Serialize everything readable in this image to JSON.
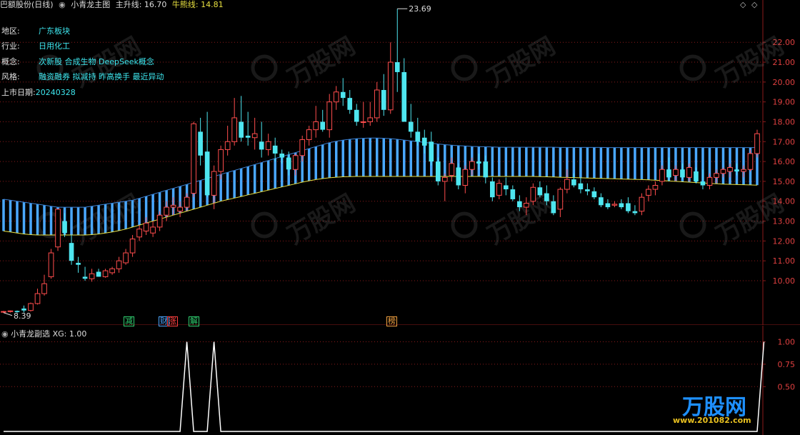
{
  "header": {
    "stock_name": "巴额股份(日线)",
    "indicator": "小青龙主图",
    "main_label": "主升线:",
    "main_value": "16.70",
    "bull_label": "牛熊线:",
    "bull_value": "14.81"
  },
  "info": [
    {
      "key": "地区:",
      "value": "广东板块"
    },
    {
      "key": "行业:",
      "value": "日用化工"
    },
    {
      "key": "概念:",
      "value": "次新股 合成生物 DeepSeek概念"
    },
    {
      "key": "风格:",
      "value": "融资融券 拟减持 昨高换手 最近异动"
    },
    {
      "key": "上市日期:",
      "value": "20240328"
    }
  ],
  "marks": [
    {
      "text": "减",
      "color": "#30d070"
    },
    {
      "text": "财",
      "color": "#4da6ff"
    },
    {
      "text": "涨",
      "color": "#ff4040"
    },
    {
      "text": "解",
      "color": "#30d070"
    },
    {
      "text": "榜",
      "color": "#f0a040"
    }
  ],
  "sub_header": {
    "title": "小青龙副选",
    "label": "XG:",
    "value": "1.00"
  },
  "watermark": {
    "logo": "万股网",
    "url": "www.201082.com"
  },
  "colors": {
    "up": "#ff4d4d",
    "down": "#4ee6f0",
    "band": "#4aa8ff",
    "line": "#e8e040",
    "grid": "#8b1a1a"
  },
  "chart_data": [
    {
      "type": "candlestick",
      "ylim": [
        7.95,
        23.95
      ],
      "yticks": [
        "22.00",
        "21.00",
        "20.00",
        "19.00",
        "18.00",
        "17.00",
        "16.00",
        "15.00",
        "14.00",
        "13.00",
        "12.00",
        "11.00",
        "10.00"
      ],
      "annotations": {
        "high": "23.69",
        "low": "8.39",
        "high_value": 23.69,
        "low_value": 8.39
      },
      "candles": [
        [
          8.42,
          8.48,
          8.38,
          8.45
        ],
        [
          8.45,
          8.5,
          8.4,
          8.48
        ],
        [
          8.48,
          8.5,
          8.39,
          8.42
        ],
        [
          8.6,
          8.75,
          8.4,
          8.5
        ],
        [
          8.5,
          8.9,
          8.45,
          8.85
        ],
        [
          8.85,
          9.6,
          8.8,
          9.35
        ],
        [
          9.35,
          10.3,
          9.25,
          9.85
        ],
        [
          10.2,
          11.6,
          10.1,
          11.4
        ],
        [
          11.7,
          13.5,
          11.5,
          13.6
        ],
        [
          13.0,
          13.4,
          12.2,
          12.4
        ],
        [
          11.9,
          12.3,
          10.8,
          11.0
        ],
        [
          10.9,
          11.2,
          10.4,
          10.8
        ],
        [
          10.2,
          10.7,
          10.0,
          10.1
        ],
        [
          10.1,
          10.6,
          9.95,
          10.35
        ],
        [
          10.45,
          10.6,
          10.2,
          10.2
        ],
        [
          10.2,
          10.6,
          10.15,
          10.5
        ],
        [
          10.4,
          10.7,
          10.3,
          10.6
        ],
        [
          10.6,
          11.2,
          10.4,
          11.0
        ],
        [
          10.9,
          11.6,
          10.8,
          11.4
        ],
        [
          11.4,
          12.3,
          11.2,
          12.1
        ],
        [
          12.2,
          12.8,
          12.0,
          12.6
        ],
        [
          12.5,
          13.2,
          12.3,
          12.9
        ],
        [
          12.4,
          13.0,
          12.2,
          12.7
        ],
        [
          12.7,
          13.5,
          12.5,
          13.3
        ],
        [
          13.3,
          14.0,
          13.0,
          13.7
        ],
        [
          13.7,
          14.2,
          13.3,
          13.8
        ],
        [
          13.5,
          14.0,
          13.2,
          13.7
        ],
        [
          13.7,
          14.4,
          13.5,
          14.2
        ],
        [
          14.4,
          18.0,
          14.2,
          17.9
        ],
        [
          17.5,
          18.2,
          15.8,
          16.3
        ],
        [
          16.5,
          18.5,
          14.2,
          14.3
        ],
        [
          14.3,
          15.8,
          13.6,
          15.5
        ],
        [
          15.5,
          16.8,
          15.1,
          16.6
        ],
        [
          16.6,
          17.8,
          16.3,
          17.0
        ],
        [
          17.0,
          19.2,
          16.8,
          18.2
        ],
        [
          18.0,
          19.3,
          17.0,
          17.2
        ],
        [
          17.3,
          18.5,
          16.8,
          17.2
        ],
        [
          17.2,
          18.2,
          16.6,
          17.4
        ],
        [
          17.0,
          18.0,
          16.2,
          16.6
        ],
        [
          16.6,
          17.4,
          16.3,
          17.0
        ],
        [
          16.8,
          17.2,
          16.0,
          16.4
        ],
        [
          16.4,
          16.6,
          15.9,
          16.2
        ],
        [
          16.2,
          16.5,
          15.3,
          15.6
        ],
        [
          15.6,
          16.4,
          15.3,
          16.3
        ],
        [
          16.3,
          17.3,
          16.0,
          17.1
        ],
        [
          17.1,
          17.8,
          16.8,
          17.6
        ],
        [
          17.6,
          18.8,
          17.2,
          18.0
        ],
        [
          18.0,
          18.6,
          17.5,
          17.6
        ],
        [
          17.6,
          19.4,
          17.2,
          19.0
        ],
        [
          19.0,
          19.8,
          18.6,
          19.5
        ],
        [
          19.5,
          20.2,
          18.8,
          19.2
        ],
        [
          19.2,
          19.6,
          18.4,
          18.6
        ],
        [
          18.6,
          18.9,
          17.8,
          18.0
        ],
        [
          18.0,
          19.0,
          17.7,
          18.0
        ],
        [
          18.0,
          19.0,
          17.8,
          18.2
        ],
        [
          18.2,
          20.0,
          18.0,
          19.6
        ],
        [
          19.6,
          20.4,
          18.3,
          18.6
        ],
        [
          18.6,
          22.0,
          18.4,
          21.0
        ],
        [
          21.0,
          23.69,
          19.5,
          20.5
        ],
        [
          20.5,
          21.2,
          18.2,
          18.0
        ],
        [
          18.0,
          18.9,
          17.2,
          17.5
        ],
        [
          17.5,
          18.2,
          16.8,
          17.0
        ],
        [
          17.2,
          17.6,
          16.4,
          16.8
        ],
        [
          17.0,
          17.5,
          15.8,
          16.0
        ],
        [
          16.0,
          16.2,
          14.8,
          15.0
        ],
        [
          15.0,
          15.4,
          14.0,
          15.2
        ],
        [
          15.3,
          16.2,
          15.0,
          15.9
        ],
        [
          15.7,
          15.9,
          14.6,
          14.8
        ],
        [
          14.8,
          15.8,
          14.4,
          15.6
        ],
        [
          15.6,
          16.2,
          15.3,
          16.0
        ],
        [
          16.0,
          16.4,
          15.6,
          15.9
        ],
        [
          16.0,
          16.3,
          14.9,
          15.2
        ],
        [
          15.0,
          15.2,
          14.0,
          14.2
        ],
        [
          14.3,
          15.1,
          14.1,
          14.9
        ],
        [
          14.8,
          15.2,
          14.3,
          14.6
        ],
        [
          14.6,
          14.8,
          14.0,
          14.1
        ],
        [
          14.0,
          14.3,
          13.5,
          13.7
        ],
        [
          13.7,
          14.2,
          13.3,
          13.9
        ],
        [
          14.0,
          14.9,
          13.8,
          14.7
        ],
        [
          14.7,
          15.0,
          14.2,
          14.3
        ],
        [
          14.4,
          14.8,
          13.8,
          14.0
        ],
        [
          14.0,
          14.3,
          13.3,
          13.4
        ],
        [
          13.6,
          14.7,
          13.2,
          14.6
        ],
        [
          14.6,
          15.6,
          14.4,
          15.1
        ],
        [
          15.1,
          15.4,
          14.7,
          14.8
        ],
        [
          14.9,
          15.2,
          14.4,
          14.6
        ],
        [
          14.6,
          14.9,
          14.3,
          14.5
        ],
        [
          14.5,
          14.7,
          14.1,
          14.2
        ],
        [
          14.2,
          14.4,
          13.7,
          13.8
        ],
        [
          13.9,
          14.1,
          13.6,
          13.7
        ],
        [
          13.8,
          14.0,
          13.7,
          13.85
        ],
        [
          13.9,
          14.1,
          13.6,
          13.7
        ],
        [
          13.9,
          14.2,
          13.4,
          13.5
        ],
        [
          13.5,
          13.8,
          13.3,
          13.4
        ],
        [
          13.5,
          14.4,
          13.3,
          14.2
        ],
        [
          14.3,
          14.8,
          14.0,
          14.6
        ],
        [
          14.6,
          15.0,
          14.3,
          14.8
        ],
        [
          15.0,
          15.8,
          14.8,
          15.6
        ],
        [
          15.6,
          16.2,
          15.0,
          15.2
        ],
        [
          15.3,
          15.8,
          15.0,
          15.6
        ],
        [
          15.6,
          15.9,
          15.1,
          15.2
        ],
        [
          15.2,
          15.9,
          15.0,
          15.7
        ],
        [
          15.5,
          15.7,
          14.9,
          15.0
        ],
        [
          15.0,
          15.6,
          14.6,
          14.8
        ],
        [
          14.8,
          15.4,
          14.6,
          15.2
        ],
        [
          15.2,
          15.6,
          14.9,
          15.4
        ],
        [
          15.4,
          15.7,
          15.2,
          15.6
        ],
        [
          15.5,
          15.9,
          15.2,
          15.7
        ],
        [
          15.6,
          15.9,
          15.3,
          15.5
        ],
        [
          15.5,
          15.8,
          15.2,
          15.6
        ],
        [
          15.6,
          16.6,
          15.5,
          16.4
        ],
        [
          16.4,
          17.6,
          16.2,
          17.4
        ]
      ],
      "band_upper": [
        14.1,
        14.05,
        14.0,
        13.95,
        13.9,
        13.85,
        13.8,
        13.75,
        13.7,
        13.7,
        13.7,
        13.7,
        13.7,
        13.75,
        13.8,
        13.85,
        13.9,
        13.95,
        14.0,
        14.05,
        14.15,
        14.25,
        14.35,
        14.45,
        14.55,
        14.65,
        14.75,
        14.85,
        14.95,
        15.05,
        15.15,
        15.25,
        15.35,
        15.45,
        15.55,
        15.65,
        15.75,
        15.85,
        15.95,
        16.05,
        16.15,
        16.25,
        16.35,
        16.45,
        16.55,
        16.65,
        16.75,
        16.85,
        16.95,
        17.02,
        17.08,
        17.12,
        17.15,
        17.17,
        17.18,
        17.18,
        17.17,
        17.15,
        17.12,
        17.08,
        17.04,
        17.0,
        16.96,
        16.92,
        16.88,
        16.85,
        16.82,
        16.8,
        16.78,
        16.76,
        16.75,
        16.74,
        16.73,
        16.72,
        16.72,
        16.72,
        16.72,
        16.72,
        16.72,
        16.72,
        16.72,
        16.72,
        16.71,
        16.71,
        16.71,
        16.71,
        16.71,
        16.71,
        16.71,
        16.7,
        16.7,
        16.7,
        16.7,
        16.7,
        16.7,
        16.7,
        16.7,
        16.7,
        16.7,
        16.7,
        16.7,
        16.7,
        16.7,
        16.7,
        16.7,
        16.7,
        16.7,
        16.7,
        16.7,
        16.7,
        16.7,
        16.7,
        16.7
      ],
      "band_lower": [
        12.5,
        12.45,
        12.4,
        12.35,
        12.32,
        12.3,
        12.3,
        12.3,
        12.3,
        12.3,
        12.3,
        12.3,
        12.3,
        12.32,
        12.35,
        12.4,
        12.45,
        12.52,
        12.6,
        12.7,
        12.8,
        12.9,
        13.0,
        13.1,
        13.2,
        13.3,
        13.4,
        13.5,
        13.6,
        13.7,
        13.8,
        13.9,
        14.0,
        14.08,
        14.16,
        14.24,
        14.32,
        14.4,
        14.48,
        14.56,
        14.64,
        14.72,
        14.8,
        14.88,
        14.96,
        15.03,
        15.09,
        15.14,
        15.18,
        15.21,
        15.23,
        15.24,
        15.25,
        15.25,
        15.25,
        15.25,
        15.25,
        15.25,
        15.25,
        15.25,
        15.25,
        15.25,
        15.25,
        15.25,
        15.25,
        15.25,
        15.25,
        15.25,
        15.25,
        15.25,
        15.25,
        15.25,
        15.25,
        15.25,
        15.25,
        15.25,
        15.25,
        15.25,
        15.25,
        15.24,
        15.23,
        15.22,
        15.21,
        15.2,
        15.19,
        15.18,
        15.17,
        15.16,
        15.15,
        15.14,
        15.13,
        15.12,
        15.11,
        15.1,
        15.09,
        15.08,
        15.06,
        15.04,
        15.02,
        15.0,
        14.98,
        14.96,
        14.94,
        14.92,
        14.9,
        14.88,
        14.86,
        14.85,
        14.84,
        14.83,
        14.82,
        14.81,
        14.81
      ]
    },
    {
      "type": "line",
      "series": [
        {
          "name": "XG",
          "values": [
            0,
            0,
            0,
            0,
            0,
            0,
            0,
            0,
            0,
            0,
            0,
            0,
            0,
            0,
            0,
            0,
            0,
            0,
            0,
            0,
            0,
            0,
            0,
            0,
            0,
            0,
            0,
            1,
            0,
            0,
            0,
            1,
            0,
            0,
            0,
            0,
            0,
            0,
            0,
            0,
            0,
            0,
            0,
            0,
            0,
            0,
            0,
            0,
            0,
            0,
            0,
            0,
            0,
            0,
            0,
            0,
            0,
            0,
            0,
            0,
            0,
            0,
            0,
            0,
            0,
            0,
            0,
            0,
            0,
            0,
            0,
            0,
            0,
            0,
            0,
            0,
            0,
            0,
            0,
            0,
            0,
            0,
            0,
            0,
            0,
            0,
            0,
            0,
            0,
            0,
            0,
            0,
            0,
            0,
            0,
            0,
            0,
            0,
            0,
            0,
            0,
            0,
            0,
            0,
            0,
            0,
            0,
            0,
            0,
            0,
            0,
            0,
            1
          ]
        }
      ],
      "ylim": [
        0,
        1.1
      ],
      "yticks": [
        "1.00",
        "0.75",
        "0.50"
      ]
    }
  ]
}
